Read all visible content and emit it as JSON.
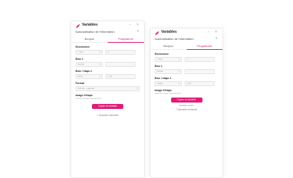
{
  "colors": {
    "accent": "#e01b78",
    "success": "#2bb673"
  },
  "panels": [
    {
      "app_title": "Variables",
      "subtitle": "Automatisation de l'information",
      "tabs": [
        "Bonjour",
        "Programme"
      ],
      "active_tab": 1,
      "labels": {
        "recherche": "Rechercher",
        "bloc1": "Bloc 1",
        "bloc2": "Bloc / étape 2",
        "format": "Format",
        "image": "Image d'étape"
      },
      "fields": {
        "recherche_sel": "Tout",
        "bloc1_sel": "Intitulé",
        "bloc2_sel": "Texte",
        "format_sel": "Format · Légende",
        "bloc2_num": "12"
      },
      "image_hint": "Aucune image sélectionnée",
      "copy_button": "Copier la variable",
      "more_label": "Nouvelle recherche"
    },
    {
      "app_title": "Variables",
      "subtitle": "Automatisation de l'information",
      "tabs": [
        "Bonjour",
        "Programme"
      ],
      "active_tab": 1,
      "labels": {
        "recherche": "Rechercher",
        "bloc1": "Bloc 1",
        "bloc2": "Bloc / étape 2",
        "image": "Image d'étape"
      },
      "fields": {
        "recherche_sel": "Tout",
        "bloc1_sel": "Intitulé",
        "bloc2_sel": "Image",
        "bloc2_num": "12"
      },
      "image_hint": "Aucune image sélectionnée",
      "copy_button": "Copier la variable",
      "status": "Variable copiée",
      "more_label": "Nouvelle recherche"
    }
  ]
}
